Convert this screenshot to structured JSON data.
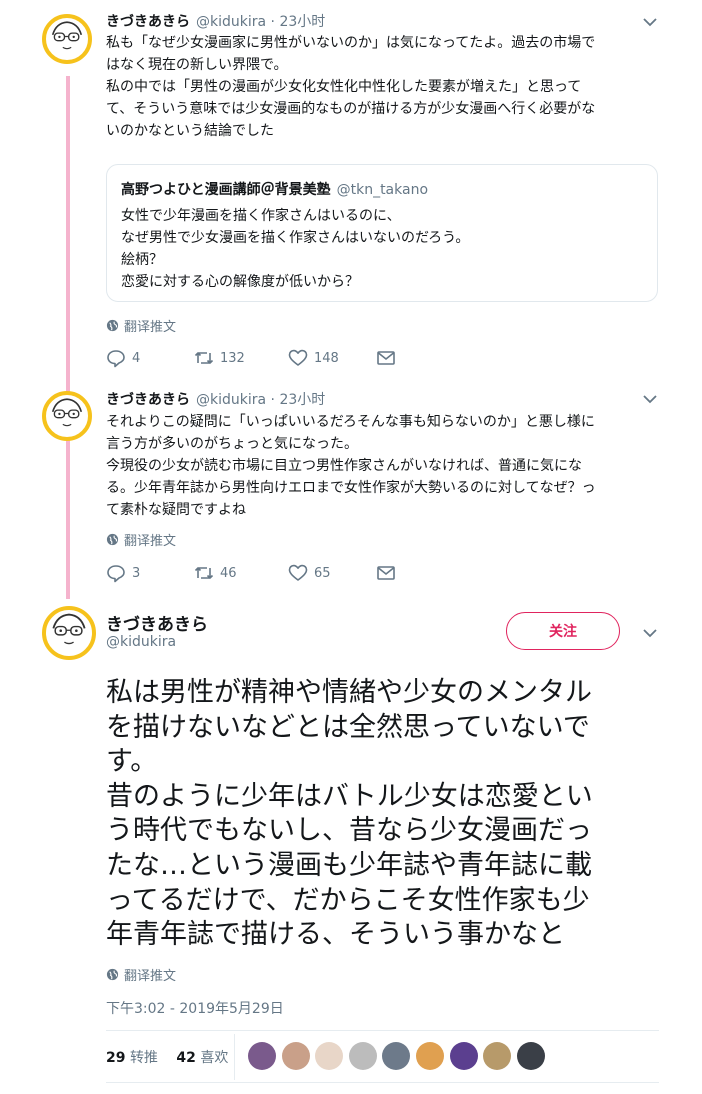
{
  "tweets": [
    {
      "name": "きづきあきら",
      "handle": "@kidukira · 23小时",
      "lines": [
        "私も「なぜ少女漫画家に男性がいないのか」は気になってたよ。過去の市場で",
        "はなく現在の新しい界隈で。",
        "私の中では「男性の漫画が少女化女性化中性化した要素が増えた」と思って",
        "て、そういう意味では少女漫画的なものが描ける方が少女漫画へ行く必要がな",
        "いのかなという結論でした"
      ],
      "quote": {
        "name": "高野つよひと漫画講師＠背景美塾",
        "handle": "@tkn_takano",
        "lines": [
          "女性で少年漫画を描く作家さんはいるのに、",
          "なぜ男性で少女漫画を描く作家さんはいないのだろう。",
          "絵柄？",
          "恋愛に対する心の解像度が低いから？"
        ]
      },
      "translate": "翻译推文",
      "replies": "4",
      "retweets": "132",
      "likes": "148"
    },
    {
      "name": "きづきあきら",
      "handle": "@kidukira · 23小时",
      "lines": [
        "それよりこの疑問に「いっぱいいるだろそんな事も知らないのか」と悪し様に",
        "言う方が多いのがちょっと気になった。",
        "今現役の少女が読む市場に目立つ男性作家さんがいなければ、普通に気にな",
        "る。少年青年誌から男性向けエロまで女性作家が大勢いるのに対してなぜ？っ",
        "て素朴な疑問ですよね"
      ],
      "translate": "翻译推文",
      "replies": "3",
      "retweets": "46",
      "likes": "65"
    }
  ],
  "main": {
    "name": "きづきあきら",
    "handle": "@kidukira",
    "follow_label": "关注",
    "lines": [
      "私は男性が精神や情緒や少女のメンタル",
      "を描けないなどとは全然思っていないで",
      "す。",
      "昔のように少年はバトル少女は恋愛とい",
      "う時代でもないし、昔なら少女漫画だっ",
      "たな…という漫画も少年誌や青年誌に載",
      "ってるだけで、だからこそ女性作家も少",
      "年青年誌で描ける、そういう事かなと"
    ],
    "translate": "翻译推文",
    "timestamp": "下午3:02 - 2019年5月29日",
    "retweets_count": "29",
    "retweets_label": "转推",
    "likes_count": "42",
    "likes_label": "喜欢",
    "likers": [
      "#7a5a8c",
      "#c9a089",
      "#e8d6c8",
      "#bcbcbc",
      "#6d7a8a",
      "#e0a050",
      "#5b3f8f",
      "#b79a6a",
      "#3a3f47"
    ]
  },
  "colors": {
    "thread_line": "#f5b3cd",
    "follow_accent": "#e0245e",
    "avatar_ring": "#f6c21c",
    "secondary_text": "#657786"
  },
  "icons": [
    "caret-down-icon",
    "globe-icon",
    "reply-icon",
    "retweet-icon",
    "like-icon",
    "envelope-icon"
  ]
}
